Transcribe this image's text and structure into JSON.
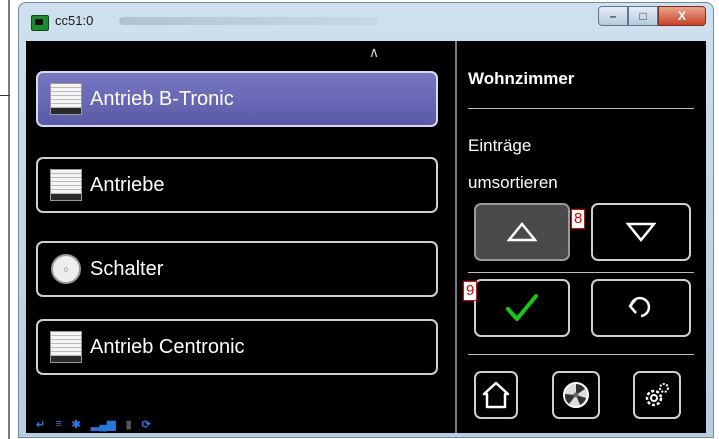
{
  "window": {
    "title": "cc51:0",
    "minimize_label": "–",
    "maximize_label": "□",
    "close_label": "X"
  },
  "list": {
    "scroll_up_glyph": "∧",
    "items": [
      {
        "label": "Antrieb B-Tronic",
        "icon": "shutter-icon",
        "selected": true
      },
      {
        "label": "Antriebe",
        "icon": "shutter-icon",
        "selected": false
      },
      {
        "label": "Schalter",
        "icon": "switch-icon",
        "selected": false
      },
      {
        "label": "Antrieb Centronic",
        "icon": "shutter-icon",
        "selected": false
      }
    ]
  },
  "panel": {
    "room_title": "Wohnzimmer",
    "sort_text_1": "Einträge",
    "sort_text_2": "umsortieren"
  },
  "markers": {
    "marker_8": "8",
    "marker_9": "9"
  },
  "colors": {
    "selected_item": "#6a6ab5",
    "confirm_check": "#19c51b",
    "status_icons": "#2877d8"
  }
}
